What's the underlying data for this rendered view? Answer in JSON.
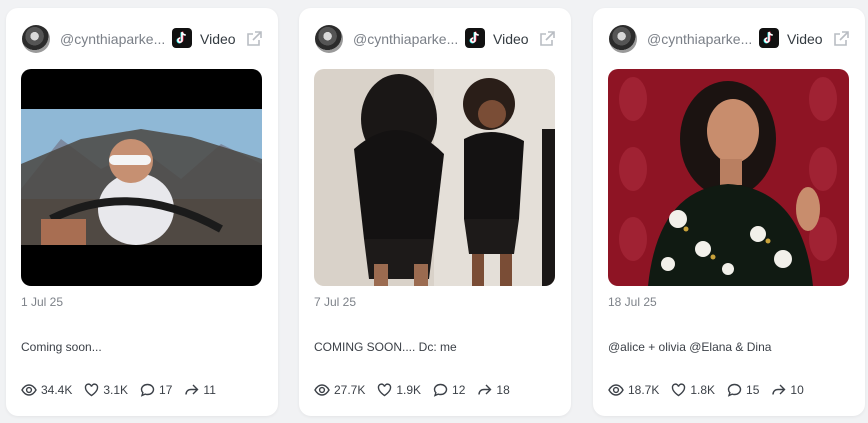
{
  "cards": [
    {
      "username": "@cynthiaparke...",
      "type_label": "Video",
      "date": "1 Jul 25",
      "caption": "Coming soon...",
      "stats": {
        "views": "34.4K",
        "likes": "3.1K",
        "comments": "17",
        "shares": "11"
      }
    },
    {
      "username": "@cynthiaparke...",
      "type_label": "Video",
      "date": "7 Jul 25",
      "caption": "COMING SOON.... Dc: me",
      "stats": {
        "views": "27.7K",
        "likes": "1.9K",
        "comments": "12",
        "shares": "18"
      }
    },
    {
      "username": "@cynthiaparke...",
      "type_label": "Video",
      "date": "18 Jul 25",
      "caption": "@alice + olivia @Elana & Dina",
      "stats": {
        "views": "18.7K",
        "likes": "1.8K",
        "comments": "15",
        "shares": "10"
      }
    }
  ],
  "colors": {
    "background": "#f1f2f4",
    "card": "#ffffff",
    "muted_text": "#7a7f87",
    "body_text": "#3c4148"
  }
}
